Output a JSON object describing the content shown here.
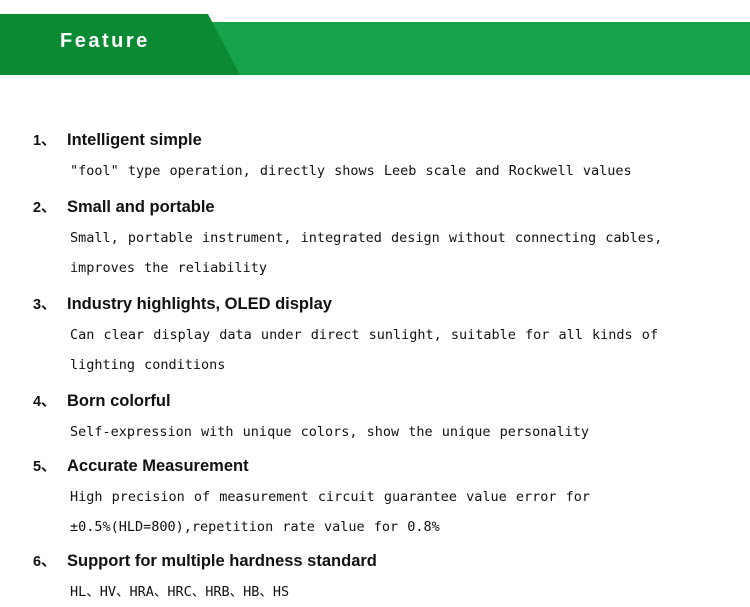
{
  "banner": {
    "title": "Feature",
    "bar_color": "#16a34a",
    "tab_color": "#0a8a33",
    "title_color": "#ffffff"
  },
  "features": [
    {
      "number": "1、",
      "title": "Intelligent simple",
      "desc_lines": [
        "\"fool\" type operation, directly shows Leeb scale and Rockwell values"
      ]
    },
    {
      "number": "2、",
      "title": "Small and portable",
      "desc_lines": [
        "Small, portable instrument, integrated design without connecting cables,",
        "improves the reliability"
      ]
    },
    {
      "number": "3、",
      "title": "Industry highlights, OLED display",
      "desc_lines": [
        "Can clear display data under direct sunlight, suitable for all kinds of",
        "lighting conditions"
      ]
    },
    {
      "number": "4、",
      "title": "Born colorful",
      "desc_lines": [
        "Self-expression with unique colors, show the unique personality"
      ]
    },
    {
      "number": "5、",
      "title": "Accurate Measurement",
      "desc_lines": [
        "High precision of measurement circuit guarantee value error for",
        "±0.5%(HLD=800),repetition rate value for 0.8%"
      ]
    },
    {
      "number": "6、",
      "title": "Support for multiple hardness standard",
      "desc_lines": [
        "HL、HV、HRA、HRC、HRB、HB、HS"
      ]
    }
  ]
}
